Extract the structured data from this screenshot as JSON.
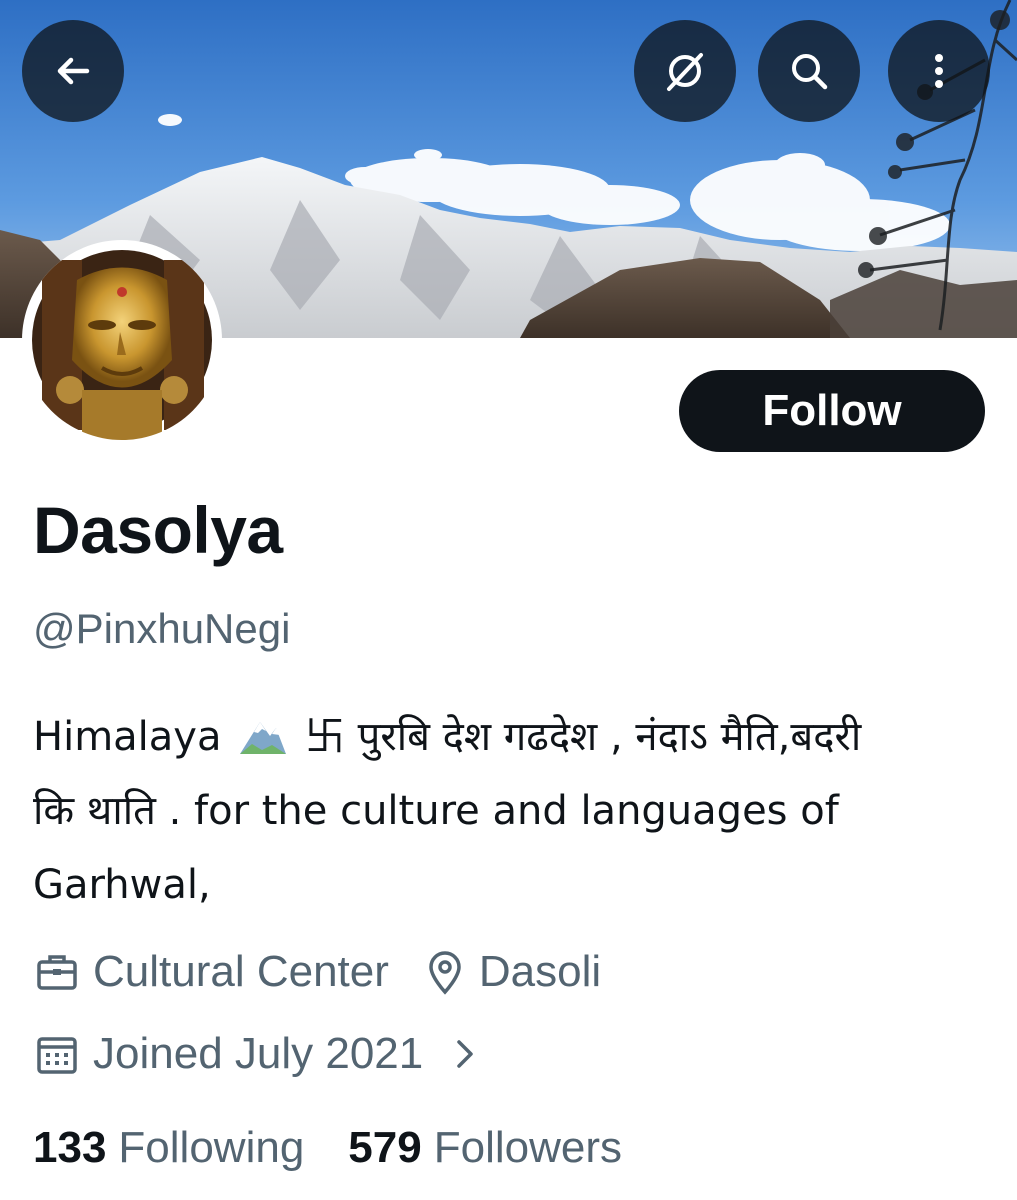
{
  "header": {
    "back_icon": "arrow-left-icon",
    "action_icons": [
      "grok-icon",
      "search-icon",
      "more-vertical-icon"
    ]
  },
  "profile": {
    "display_name": "Dasolya",
    "handle": "@PinxhuNegi",
    "follow_label": "Follow",
    "bio_lines": [
      "Himalaya ⛰ 卐 पुरबि देश गढदेश , नंदाऽ मैति,बदरी",
      "कि थाति .   for the culture and languages  of",
      "Garhwal,"
    ],
    "bio_emoji_icon": "snow-capped-mountain-icon",
    "category": "Cultural Center",
    "location": "Dasoli",
    "joined": "Joined July 2021"
  },
  "stats": {
    "following_count": "133",
    "following_label": "Following",
    "followers_count": "579",
    "followers_label": "Followers"
  },
  "colors": {
    "text_primary": "#0f1419",
    "text_secondary": "#536471",
    "button_dark": "#0f1419",
    "sky_blue": "#3d7fcf"
  }
}
